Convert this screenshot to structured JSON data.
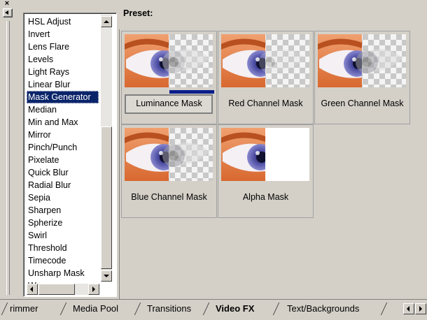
{
  "window": {
    "close_glyph": "×"
  },
  "effects_list": {
    "items": [
      "HSL Adjust",
      "Invert",
      "Lens Flare",
      "Levels",
      "Light Rays",
      "Linear Blur",
      "Mask Generator",
      "Median",
      "Min and Max",
      "Mirror",
      "Pinch/Punch",
      "Pixelate",
      "Quick Blur",
      "Radial Blur",
      "Sepia",
      "Sharpen",
      "Spherize",
      "Swirl",
      "Threshold",
      "Timecode",
      "Unsharp Mask",
      "Wave"
    ],
    "selected": "Mask Generator"
  },
  "preset": {
    "label": "Preset:",
    "tiles": [
      {
        "label": "Luminance Mask",
        "variant": "luminance",
        "selected": true
      },
      {
        "label": "Red Channel Mask",
        "variant": "red",
        "selected": false
      },
      {
        "label": "Green Channel Mask",
        "variant": "green",
        "selected": false
      },
      {
        "label": "Blue Channel Mask",
        "variant": "blue",
        "selected": false
      },
      {
        "label": "Alpha Mask",
        "variant": "alpha",
        "selected": false
      }
    ]
  },
  "tabs": [
    {
      "label": "rimmer",
      "active": false
    },
    {
      "label": "Media Pool",
      "active": false
    },
    {
      "label": "Transitions",
      "active": false
    },
    {
      "label": "Video FX",
      "active": true
    },
    {
      "label": "Text/Backgrounds",
      "active": false
    }
  ],
  "colors": {
    "selection": "#0a246a",
    "face_bar": "#0a1e8a"
  }
}
